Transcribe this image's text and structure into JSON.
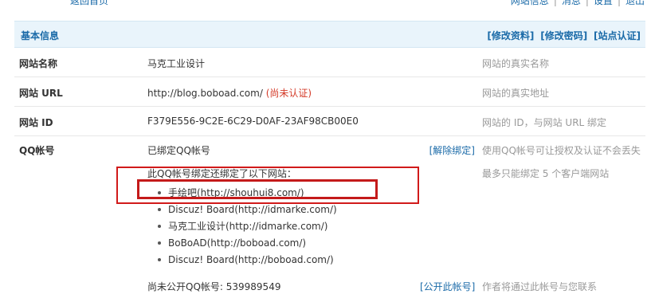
{
  "top_fragment": {
    "left_text": "返回首页",
    "right_links": [
      "网站信息",
      "消息",
      "设置",
      "退出"
    ]
  },
  "section": {
    "title": "基本信息",
    "header_links": [
      "[修改资料]",
      "[修改密码]",
      "[站点认证]"
    ]
  },
  "rows": [
    {
      "label": "网站名称",
      "value": "马克工业设计",
      "hint": "网站的真实名称"
    },
    {
      "label": "网站 URL",
      "value": "http://blog.boboad.com/",
      "status": "(尚未认证)",
      "hint": "网站的真实地址"
    },
    {
      "label": "网站 ID",
      "value": "F379E556-9C2E-6C29-D0AF-23AF98CB00E0",
      "hint": "网站的 ID，与网站 URL 绑定"
    },
    {
      "label": "QQ帐号",
      "value": "已绑定QQ帐号",
      "action": "[解除绑定]",
      "hint": "使用QQ帐号可让授权及认证不会丢失"
    }
  ],
  "bound_sites": {
    "intro": "此QQ帐号绑定还绑定了以下网站：",
    "hint": "最多只能绑定 5 个客户端网站",
    "items": [
      "手绘吧(http://shouhui8.com/)",
      "Discuz! Board(http://idmarke.com/)",
      "马克工业设计(http://idmarke.com/)",
      "BoBoAD(http://boboad.com/)",
      "Discuz! Board(http://boboad.com/)"
    ]
  },
  "qq_public": {
    "text": "尚未公开QQ帐号: 539989549",
    "action": "[公开此帐号]",
    "hint": "作者将通过此帐号与您联系"
  },
  "colors": {
    "link": "#1a6aa8",
    "header_bg": "#e9f4fb",
    "hint": "#999999",
    "warning": "#d43c2a",
    "annotation_box": "#d11a1a"
  }
}
